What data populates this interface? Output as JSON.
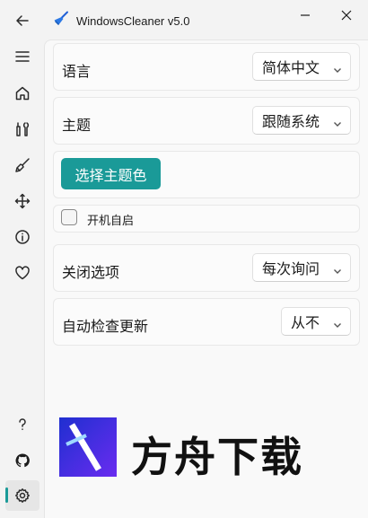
{
  "app": {
    "title": "WindowsCleaner v5.0"
  },
  "nav": {
    "items": [
      {
        "icon": "back-arrow-icon"
      },
      {
        "icon": "menu-icon"
      },
      {
        "icon": "home-icon"
      },
      {
        "icon": "tools-icon"
      },
      {
        "icon": "broom-icon"
      },
      {
        "icon": "move-icon"
      },
      {
        "icon": "info-icon"
      },
      {
        "icon": "heart-icon"
      },
      {
        "icon": "help-icon"
      },
      {
        "icon": "github-icon"
      },
      {
        "icon": "settings-icon"
      }
    ],
    "active_item": "settings-icon"
  },
  "settings": {
    "language": {
      "label": "语言",
      "value": "简体中文"
    },
    "theme": {
      "label": "主题",
      "value": "跟随系统"
    },
    "theme_color_button": "选择主题色",
    "autostart": {
      "label": "开机自启",
      "checked": false
    },
    "close_option": {
      "label": "关闭选项",
      "value": "每次询问"
    },
    "auto_update": {
      "label": "自动检查更新",
      "value": "从不"
    }
  },
  "watermark": {
    "text": "方舟下载"
  },
  "colors": {
    "accent": "#1a9a98",
    "background": "#f3f3f3",
    "content": "#f9f9f9"
  }
}
